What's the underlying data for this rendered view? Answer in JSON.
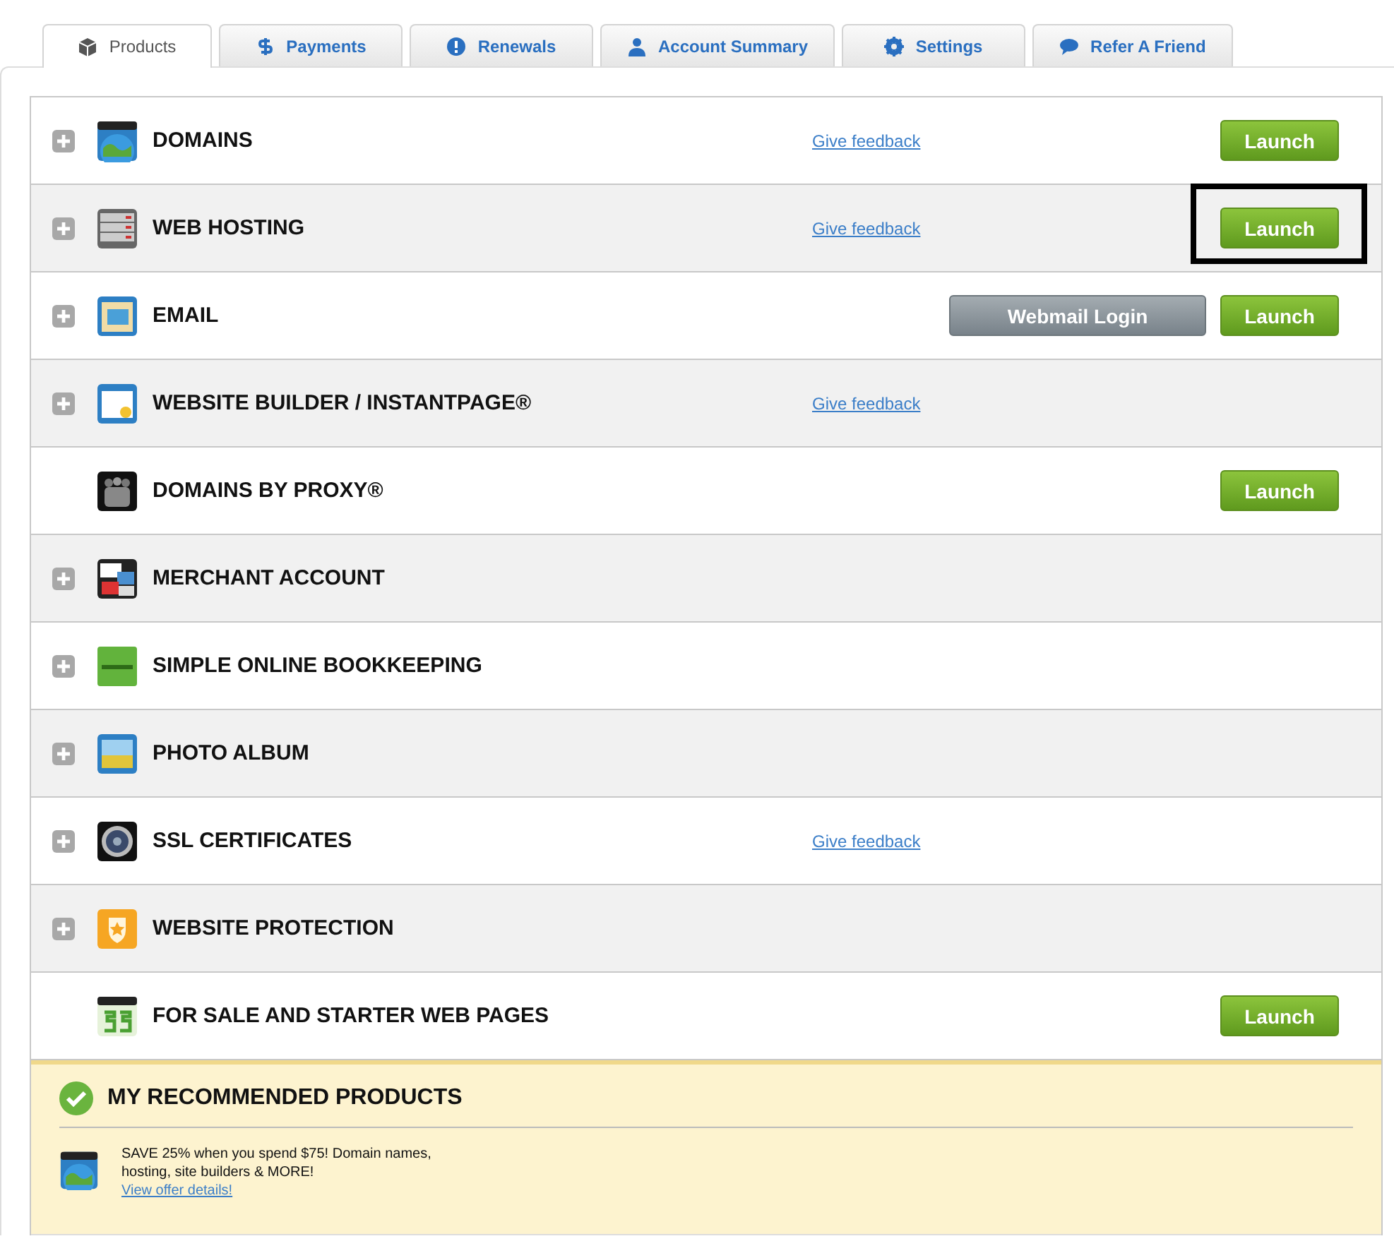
{
  "tabs": [
    {
      "label": "Products",
      "kind": "box",
      "selected": true
    },
    {
      "label": "Payments",
      "kind": "dollar",
      "selected": false
    },
    {
      "label": "Renewals",
      "kind": "alert",
      "selected": false
    },
    {
      "label": "Account Summary",
      "kind": "person",
      "selected": false
    },
    {
      "label": "Settings",
      "kind": "gear",
      "selected": false
    },
    {
      "label": "Refer A Friend",
      "kind": "bubble",
      "selected": false
    }
  ],
  "products": [
    {
      "name": "DOMAINS",
      "kind": "globe",
      "expandable": true,
      "feedback": "Give feedback",
      "buttons": [
        {
          "kind": "launch",
          "label": "Launch",
          "highlighted": false
        }
      ]
    },
    {
      "name": "WEB HOSTING",
      "kind": "server",
      "expandable": true,
      "feedback": "Give feedback",
      "buttons": [
        {
          "kind": "launch",
          "label": "Launch",
          "highlighted": true
        }
      ]
    },
    {
      "name": "EMAIL",
      "kind": "mail",
      "expandable": true,
      "buttons": [
        {
          "kind": "webmail",
          "label": "Webmail Login"
        },
        {
          "kind": "launch",
          "label": "Launch",
          "highlighted": false
        }
      ]
    },
    {
      "name": "WEBSITE BUILDER / INSTANTPAGE®",
      "kind": "builder",
      "expandable": true,
      "feedback": "Give feedback"
    },
    {
      "name": "DOMAINS BY PROXY®",
      "kind": "people",
      "expandable": false,
      "buttons": [
        {
          "kind": "launch",
          "label": "Launch",
          "highlighted": false
        }
      ]
    },
    {
      "name": "MERCHANT ACCOUNT",
      "kind": "cards",
      "expandable": true
    },
    {
      "name": "SIMPLE ONLINE BOOKKEEPING",
      "kind": "books",
      "expandable": true
    },
    {
      "name": "PHOTO ALBUM",
      "kind": "photo",
      "expandable": true
    },
    {
      "name": "SSL CERTIFICATES",
      "kind": "lock",
      "expandable": true,
      "feedback": "Give feedback"
    },
    {
      "name": "WEBSITE PROTECTION",
      "kind": "shield",
      "expandable": true
    },
    {
      "name": "FOR SALE AND STARTER WEB PAGES",
      "kind": "money",
      "expandable": false,
      "buttons": [
        {
          "kind": "launch",
          "label": "Launch",
          "highlighted": false
        }
      ]
    }
  ],
  "recommended": {
    "title": "MY RECOMMENDED PRODUCTS",
    "offers": [
      {
        "text": "SAVE 25% when you spend $75! Domain names, hosting, site builders & MORE!",
        "link": "View offer details!"
      }
    ]
  }
}
